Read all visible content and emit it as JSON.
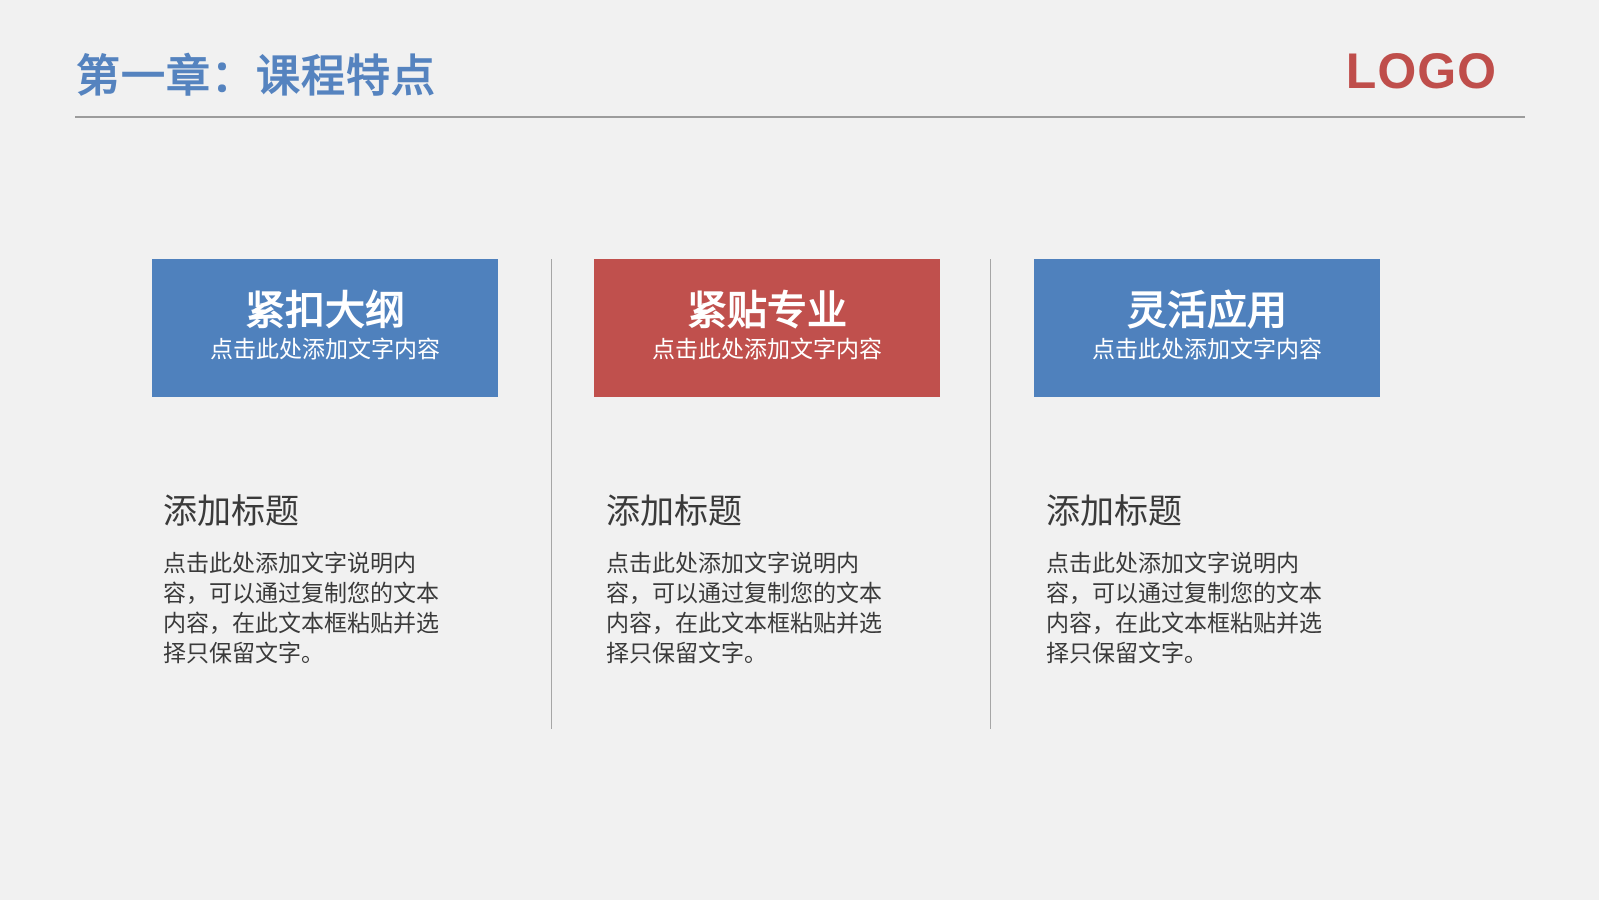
{
  "header": {
    "title": "第一章：课程特点",
    "logo": "LOGO"
  },
  "colors": {
    "title": "#5583bf",
    "logo": "#bf4e4b",
    "blue_box": "#4f81bd",
    "red_box": "#c0504d",
    "background": "#f1f1f1",
    "body_text": "#3a3a3a"
  },
  "columns": [
    {
      "box_title": "紧扣大纲",
      "box_subtitle": "点击此处添加文字内容",
      "box_color": "blue",
      "heading": "添加标题",
      "description": "点击此处添加文字说明内容，可以通过复制您的文本内容，在此文本框粘贴并选择只保留文字。"
    },
    {
      "box_title": "紧贴专业",
      "box_subtitle": "点击此处添加文字内容",
      "box_color": "red",
      "heading": "添加标题",
      "description": "点击此处添加文字说明内容，可以通过复制您的文本内容，在此文本框粘贴并选择只保留文字。"
    },
    {
      "box_title": "灵活应用",
      "box_subtitle": "点击此处添加文字内容",
      "box_color": "blue",
      "heading": "添加标题",
      "description": "点击此处添加文字说明内容，可以通过复制您的文本内容，在此文本框粘贴并选择只保留文字。"
    }
  ]
}
